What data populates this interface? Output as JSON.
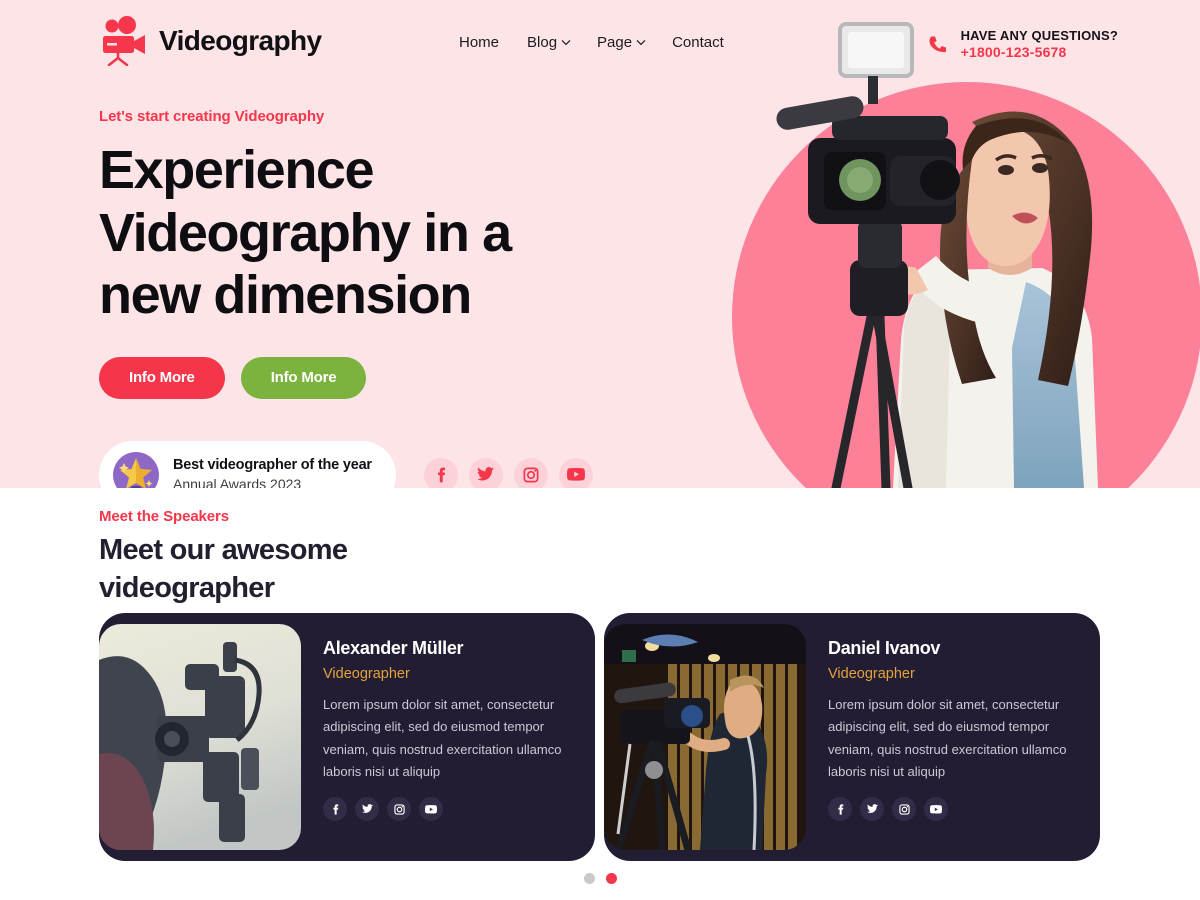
{
  "brand": {
    "name": "Videography",
    "icon": "video-camera-icon",
    "color": "#f5364b"
  },
  "nav": {
    "items": [
      {
        "label": "Home",
        "has_dropdown": false
      },
      {
        "label": "Blog",
        "has_dropdown": true
      },
      {
        "label": "Page",
        "has_dropdown": true
      },
      {
        "label": "Contact",
        "has_dropdown": false
      }
    ]
  },
  "contact": {
    "icon": "phone-icon",
    "label": "HAVE ANY QUESTIONS?",
    "number": "+1800-123-5678"
  },
  "hero": {
    "eyebrow": "Let's start creating Videography",
    "title": "Experience Videography in a new dimension",
    "primary_button": "Info More",
    "secondary_button": "Info More",
    "award": {
      "icon": "trophy-icon",
      "title": "Best videographer of the year",
      "subtitle": "Annual Awards 2023"
    },
    "socials": [
      {
        "name": "facebook-icon"
      },
      {
        "name": "twitter-icon"
      },
      {
        "name": "instagram-icon"
      },
      {
        "name": "youtube-icon"
      }
    ],
    "image_alt": "woman-operating-video-camera-on-tripod",
    "background": "#fde4e7",
    "blob_color": "#fc8097",
    "accent": "#f5364b",
    "secondary_accent": "#7cb33f"
  },
  "speakers": {
    "eyebrow": "Meet the Speakers",
    "title": "Meet our awesome videographer",
    "cards": [
      {
        "name": "Alexander Müller",
        "role": "Videographer",
        "description": "Lorem ipsum dolor sit amet, consectetur adipiscing elit, sed do eiusmod tempor veniam, quis nostrud exercitation ullamco laboris nisi ut aliquip",
        "image_alt": "videographer-behind-camera-outdoors",
        "socials": [
          "facebook-icon",
          "twitter-icon",
          "instagram-icon",
          "youtube-icon"
        ]
      },
      {
        "name": "Daniel Ivanov",
        "role": "Videographer",
        "description": "Lorem ipsum dolor sit amet, consectetur adipiscing elit, sed do eiusmod tempor veniam, quis nostrud exercitation ullamco laboris nisi ut aliquip",
        "image_alt": "man-with-video-camera-in-studio",
        "socials": [
          "facebook-icon",
          "twitter-icon",
          "instagram-icon",
          "youtube-icon"
        ]
      }
    ],
    "card_background": "#221d33",
    "role_color": "#e3a33a",
    "pagination": {
      "count": 2,
      "active_index": 1
    }
  }
}
